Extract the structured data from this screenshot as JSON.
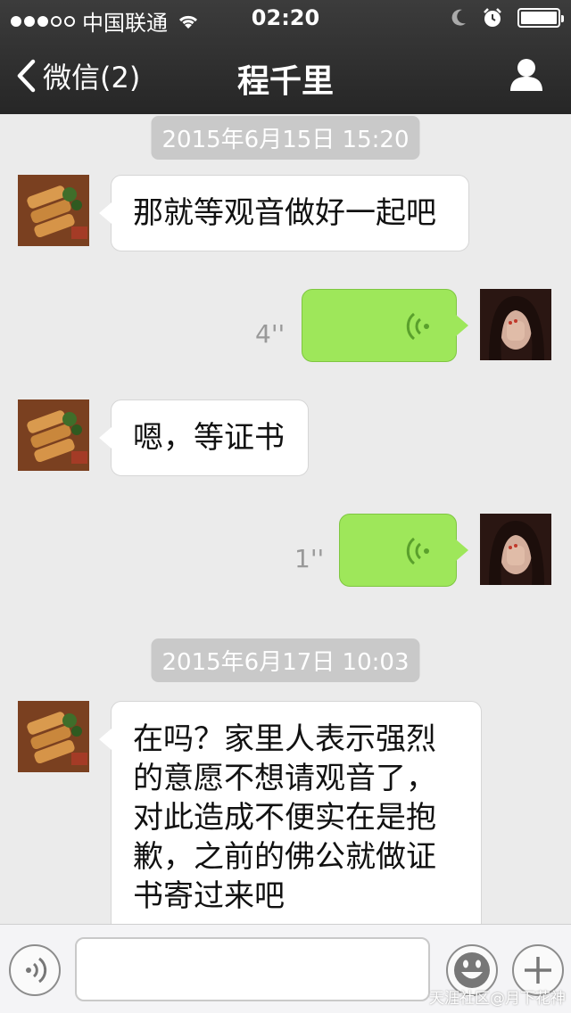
{
  "status_bar": {
    "carrier": "中国联通",
    "time": "02:20"
  },
  "nav": {
    "back_label": "微信(2)",
    "title": "程千里"
  },
  "messages": {
    "ts1": "2015年6月15日 15:20",
    "m1": "那就等观音做好一起吧",
    "v1_duration": "4''",
    "m2": "嗯，等证书",
    "v2_duration": "1''",
    "ts2": "2015年6月17日 10:03",
    "m3_line1": "在吗？家里人表示强烈",
    "m3_line2": "的意愿不想请观音了，",
    "m3_line3": "对此造成不便实在是抱",
    "m3_line4": "歉，之前的佛公就做证",
    "m3_line5": "书寄过来吧"
  },
  "input_bar": {
    "watermark": "天涯社区@月下花神"
  },
  "colors": {
    "voice_bubble": "#9ee75a",
    "nav_background": "#2e2e2e",
    "chat_background": "#ebebeb"
  },
  "icons": [
    "wifi-icon",
    "moon-icon",
    "alarm-icon",
    "battery-icon",
    "back-chevron-icon",
    "profile-icon",
    "voice-wave-icon",
    "voice-input-icon",
    "emoji-icon",
    "plus-icon"
  ]
}
